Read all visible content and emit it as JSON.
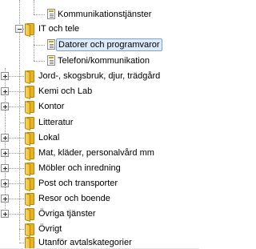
{
  "tree": {
    "nodes": [
      {
        "label": "Kommunikationstjänster",
        "icon": "document-icon",
        "level": 2,
        "expander": "none",
        "selected": false
      },
      {
        "label": "IT och tele",
        "icon": "folder-open-icon",
        "level": 1,
        "expander": "minus",
        "selected": false
      },
      {
        "label": "Datorer och programvaror",
        "icon": "document-icon",
        "level": 2,
        "expander": "none",
        "selected": true
      },
      {
        "label": "Telefoni/kommunikation",
        "icon": "document-icon",
        "level": 2,
        "expander": "none",
        "selected": false
      },
      {
        "label": "Jord-, skogsbruk, djur, trädgård",
        "icon": "folder-icon",
        "level": 1,
        "expander": "plus",
        "selected": false
      },
      {
        "label": "Kemi och Lab",
        "icon": "folder-icon",
        "level": 1,
        "expander": "plus",
        "selected": false
      },
      {
        "label": "Kontor",
        "icon": "folder-icon",
        "level": 1,
        "expander": "plus",
        "selected": false
      },
      {
        "label": "Litteratur",
        "icon": "folder-icon",
        "level": 1,
        "expander": "none",
        "selected": false
      },
      {
        "label": "Lokal",
        "icon": "folder-icon",
        "level": 1,
        "expander": "plus",
        "selected": false
      },
      {
        "label": "Mat, kläder, personalvård mm",
        "icon": "folder-icon",
        "level": 1,
        "expander": "plus",
        "selected": false
      },
      {
        "label": "Möbler och inredning",
        "icon": "folder-icon",
        "level": 1,
        "expander": "plus",
        "selected": false
      },
      {
        "label": "Post och transporter",
        "icon": "folder-icon",
        "level": 1,
        "expander": "plus",
        "selected": false
      },
      {
        "label": "Resor och boende",
        "icon": "folder-icon",
        "level": 1,
        "expander": "plus",
        "selected": false
      },
      {
        "label": "Övriga tjänster",
        "icon": "folder-icon",
        "level": 1,
        "expander": "plus",
        "selected": false
      },
      {
        "label": "Övrigt",
        "icon": "folder-icon",
        "level": 1,
        "expander": "none",
        "selected": false
      },
      {
        "label": "Utanför avtalskategorier",
        "icon": "folder-icon",
        "level": 1,
        "expander": "none",
        "selected": false
      }
    ]
  },
  "colors": {
    "selection_background": "#dcebfc",
    "selection_border": "#7da2ce",
    "folder": "#f0bd2c",
    "connector": "#9a9a9a"
  }
}
